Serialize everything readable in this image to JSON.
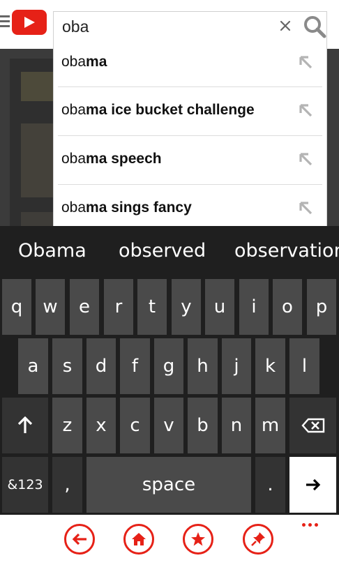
{
  "header": {
    "menu_icon": "hamburger-icon",
    "logo_icon": "youtube-logo",
    "search": {
      "value": "oba",
      "placeholder": ""
    },
    "clear_icon": "close-icon",
    "search_icon": "search-icon"
  },
  "suggestions": [
    {
      "typed": "oba",
      "completion": "ma"
    },
    {
      "typed": "oba",
      "completion": "ma ice bucket challenge"
    },
    {
      "typed": "oba",
      "completion": "ma speech"
    },
    {
      "typed": "oba",
      "completion": "ma sings fancy"
    }
  ],
  "predictions": [
    "Obama",
    "observed",
    "observation"
  ],
  "keyboard": {
    "row1": [
      "q",
      "w",
      "e",
      "r",
      "t",
      "y",
      "u",
      "i",
      "o",
      "p"
    ],
    "row2": [
      "a",
      "s",
      "d",
      "f",
      "g",
      "h",
      "j",
      "k",
      "l"
    ],
    "row3": [
      "z",
      "x",
      "c",
      "v",
      "b",
      "n",
      "m"
    ],
    "shift_icon": "shift-arrow-icon",
    "backspace_icon": "backspace-icon",
    "symbols_label": "&123",
    "comma_label": ",",
    "space_label": "space",
    "period_label": ".",
    "enter_icon": "enter-arrow-icon"
  },
  "appbar": {
    "buttons": [
      "back-icon",
      "home-icon",
      "star-icon",
      "pin-icon"
    ],
    "more_icon": "more-dots-icon"
  },
  "colors": {
    "brand_red": "#e62117",
    "key_bg": "#4a4a4a",
    "key_dark_bg": "#333333",
    "keyboard_bg": "#1f1f1f"
  }
}
